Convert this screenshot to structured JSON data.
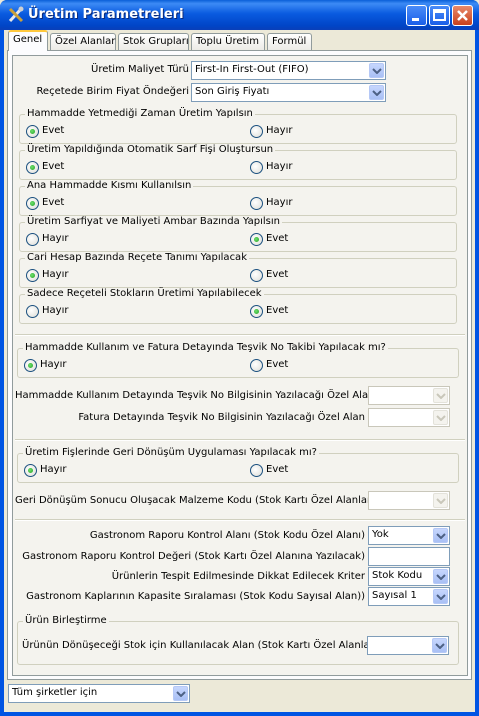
{
  "window": {
    "title": "Üretim Parametreleri"
  },
  "tabs": [
    {
      "label": "Genel",
      "active": true
    },
    {
      "label": "Özel Alanlar",
      "active": false
    },
    {
      "label": "Stok Grupları",
      "active": false
    },
    {
      "label": "Toplu Üretim",
      "active": false
    },
    {
      "label": "Formül",
      "active": false
    }
  ],
  "cost": {
    "method_label": "Üretim Maliyet Türü",
    "method_value": "First-In First-Out (FIFO)",
    "price_label": "Reçetede Birim Fiyat Öndeğeri",
    "price_value": "Son Giriş Fiyatı"
  },
  "options": {
    "yes": "Evet",
    "no": "Hayır"
  },
  "groups": [
    {
      "title": "Hammadde Yetmediği Zaman Üretim Yapılsın",
      "selected": "yes"
    },
    {
      "title": "Üretim Yapıldığında Otomatik Sarf Fişi Oluştursun",
      "selected": "yes"
    },
    {
      "title": "Ana Hammadde Kısmı Kullanılsın",
      "selected": "yes"
    },
    {
      "title": "Üretim Sarfiyat ve Maliyeti Ambar Bazında Yapılsın",
      "selected": "yes"
    },
    {
      "title": "Cari Hesap Bazında Reçete Tanımı Yapılacak",
      "selected": "no"
    },
    {
      "title": "Sadece Reçeteli Stokların Üretimi Yapılabilecek",
      "selected": "yes"
    }
  ],
  "incentive": {
    "title": "Hammadde Kullanım ve Fatura Detayında Teşvik No Takibi Yapılacak mı?",
    "selected": "no",
    "usage_label": "Hammadde Kullanım Detayında Teşvik No Bilgisinin Yazılacağı Özel Alan",
    "usage_value": "",
    "invoice_label": "Fatura Detayında Teşvik No Bilgisinin Yazılacağı Özel Alan",
    "invoice_value": ""
  },
  "recycle": {
    "title": "Üretim Fişlerinde Geri Dönüşüm Uygulaması Yapılacak mı?",
    "selected": "no",
    "code_label": "Geri Dönüşüm Sonucu Oluşacak Malzeme Kodu (Stok Kartı Özel Alanları)",
    "code_value": ""
  },
  "gastronomy": {
    "control_field_label": "Gastronom Raporu Kontrol Alanı (Stok Kodu Özel Alanı)",
    "control_field_value": "Yok",
    "control_value_label": "Gastronom Raporu Kontrol Değeri (Stok Kartı Özel Alanına Yazılacak)",
    "control_value_value": "",
    "criteria_label": "Ürünlerin Tespit Edilmesinde Dikkat Edilecek Kriter",
    "criteria_value": "Stok Kodu",
    "capacity_label": "Gastronom Kaplarının Kapasite Sıralaması (Stok Kodu Sayısal Alan))",
    "capacity_value": "Sayısal 1"
  },
  "merge": {
    "title": "Ürün Birleştirme",
    "field_label": "Ürünün Dönüşeceği Stok için Kullanılacak Alan (Stok Kartı Özel Alanları)",
    "field_value": ""
  },
  "footer": {
    "company_value": "Tüm şirketler için"
  },
  "colors": {
    "titlebar": "#0054e3",
    "radio_on": "#21a121"
  }
}
